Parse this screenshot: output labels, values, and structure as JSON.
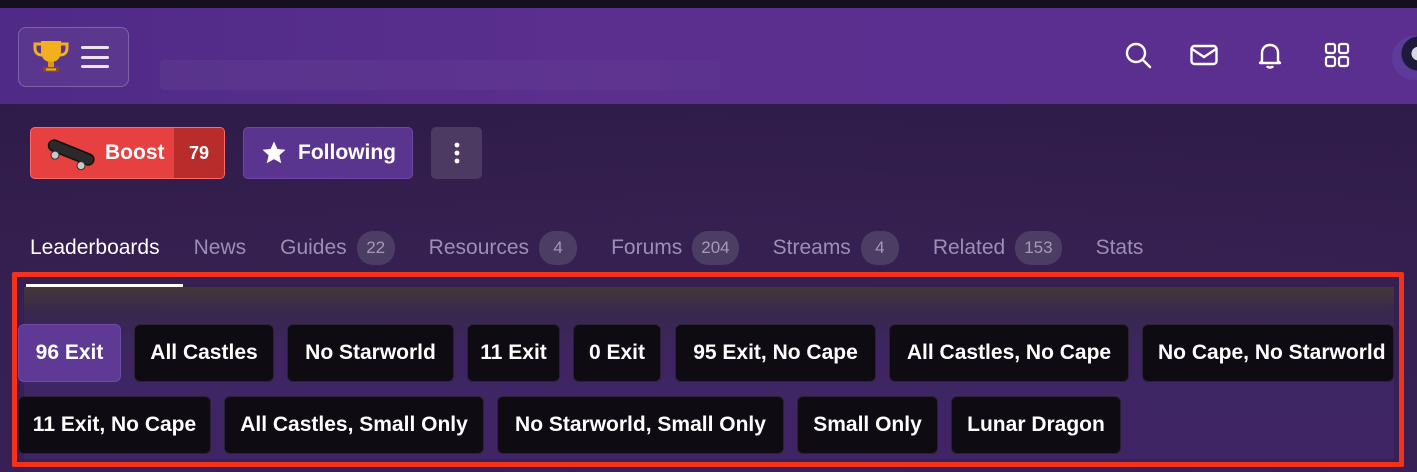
{
  "header": {
    "icons": [
      "trophy-icon",
      "hamburger-icon",
      "search-icon",
      "mail-icon",
      "bell-icon",
      "apps-grid-icon"
    ]
  },
  "actions": {
    "boost_label": "Boost",
    "boost_count": "79",
    "following_label": "Following",
    "colors": {
      "boost": "#e74040",
      "boost_count_bg": "#b82c2c",
      "following": "#5a3590"
    }
  },
  "tabs": [
    {
      "label": "Leaderboards",
      "count": ""
    },
    {
      "label": "News",
      "count": ""
    },
    {
      "label": "Guides",
      "count": "22"
    },
    {
      "label": "Resources",
      "count": "4"
    },
    {
      "label": "Forums",
      "count": "204"
    },
    {
      "label": "Streams",
      "count": "4"
    },
    {
      "label": "Related",
      "count": "153"
    },
    {
      "label": "Stats",
      "count": ""
    }
  ],
  "active_tab": "Leaderboards",
  "categories": {
    "selected": "96 Exit",
    "items": [
      "96 Exit",
      "All Castles",
      "No Starworld",
      "11 Exit",
      "0 Exit",
      "95 Exit, No Cape",
      "All Castles, No Cape",
      "No Cape, No Starworld",
      "11 Exit, No Cape",
      "All Castles, Small Only",
      "No Starworld, Small Only",
      "Small Only",
      "Lunar Dragon"
    ]
  },
  "theme": {
    "highlight": "#f2321b",
    "header": "#5a2f8e",
    "chip": "#0f0b12",
    "chip_selected": "#5e3a94"
  }
}
